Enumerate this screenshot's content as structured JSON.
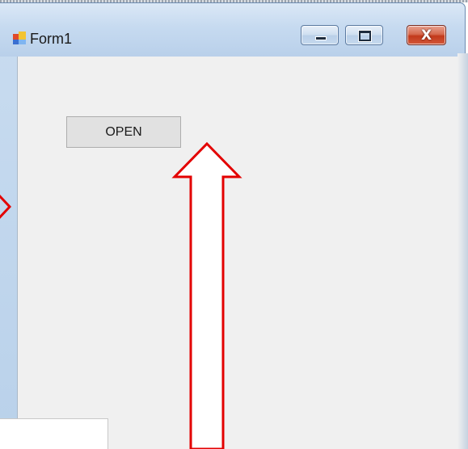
{
  "window": {
    "title": "Form1",
    "icon": "windows-form-icon",
    "controls": {
      "minimize_icon": "minimize-icon",
      "maximize_icon": "maximize-icon",
      "close_icon": "close-icon",
      "close_glyph": "X"
    }
  },
  "form": {
    "open_button_label": "OPEN"
  },
  "annotations": {
    "arrow_color": "#e30000",
    "arrow_icon": "up-arrow-icon",
    "side_marker_icon": "chevron-right-icon"
  },
  "colors": {
    "client_background": "#f0f0f0",
    "title_bar": "#c6daf0",
    "close_button": "#c2391b"
  }
}
